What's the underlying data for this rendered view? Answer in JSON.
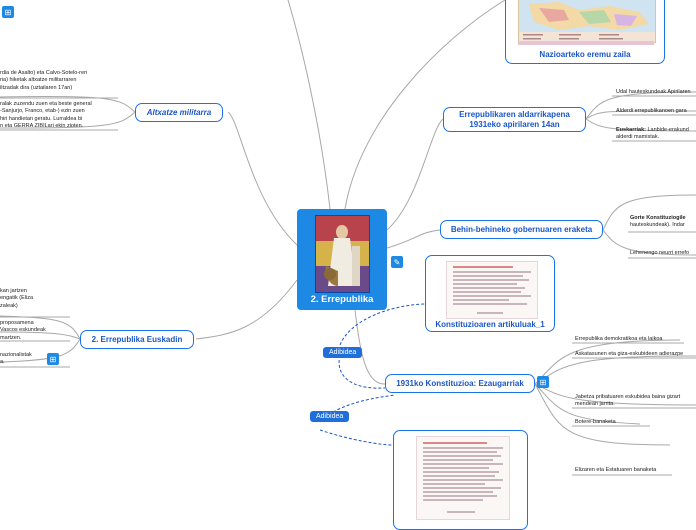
{
  "central": {
    "title": "2. Errepublika"
  },
  "left_nodes": {
    "altxatze": "Altxatze militarra",
    "euskadin": "2. Errepublika Euskadin"
  },
  "left_texts": {
    "altx_1": [
      "rdia de Asalto) eta Calvo-Sotelo-ren",
      "ria) hiketak altxatze militarraren",
      "iltzadak dira (uztailaren 17an)"
    ],
    "altx_2": [
      "ralak zuzendu zuen eta beste general",
      "-Sanjurjo, Franco, etab-) ezin zuen",
      "hiri handietan geratu. Lurraldea bi",
      "n eta GERRA ZIBILari ekin zioten."
    ],
    "eusk_1": [
      "kan jartzen",
      "engatik (Eliza",
      "zaleak)"
    ],
    "eusk_2": [
      "proposamena",
      "Vascos eskundeak",
      "martzen."
    ],
    "eusk_3": [
      "nazionalistak",
      "a."
    ]
  },
  "right_nodes": {
    "nazioarteko": "Nazioarteko eremu zaila",
    "aldarrikapena_1": "Errepublikaren aldarrikapena",
    "aldarrikapena_2": "1931eko apirilaren 14an",
    "behinbehineko": "Behin-behineko gobernuaren eraketa",
    "konst_art": "Konstituzioaren artikuluak_1",
    "konst_ezaug": "1931ko Konstituzioa: Ezaugarriak"
  },
  "right_leaves": {
    "udal": "Udal hauteskundeak Apirilaren",
    "alderdi": "Alderdi errepublikanoen gara",
    "euskarriak_label": "Euskarriak:",
    "euskarriak_1": " Lanbide-erakund",
    "euskarriak_2": "alderdi mamistak.",
    "gorte_label": "Gorte Konstituziogile",
    "gorte_2": "hauteskundeak). Indar",
    "lehenengo": "Lehenengo neurri errefo",
    "ezaug_1": "Errepublika demokratikoa eta laikoa",
    "ezaug_2": "Askatasunen eta giza-eskubideen adierazpe",
    "ezaug_3a": "Jabetza  pribatuaren eskubidea baina gizart",
    "ezaug_3b": "mendean jarrita.",
    "ezaug_4": "Botere-banaketa",
    "ezaug_5": "Elizaren eta Estatuaren banaketa"
  },
  "tags": {
    "adibidea_1": "Adibidea",
    "adibidea_2": "Adibidea"
  },
  "colors": {
    "accent": "#1e88e5",
    "line": "#a8a8a8",
    "link": "#1a56c8"
  },
  "icons": [
    "hierarchy-icon",
    "note-icon"
  ]
}
